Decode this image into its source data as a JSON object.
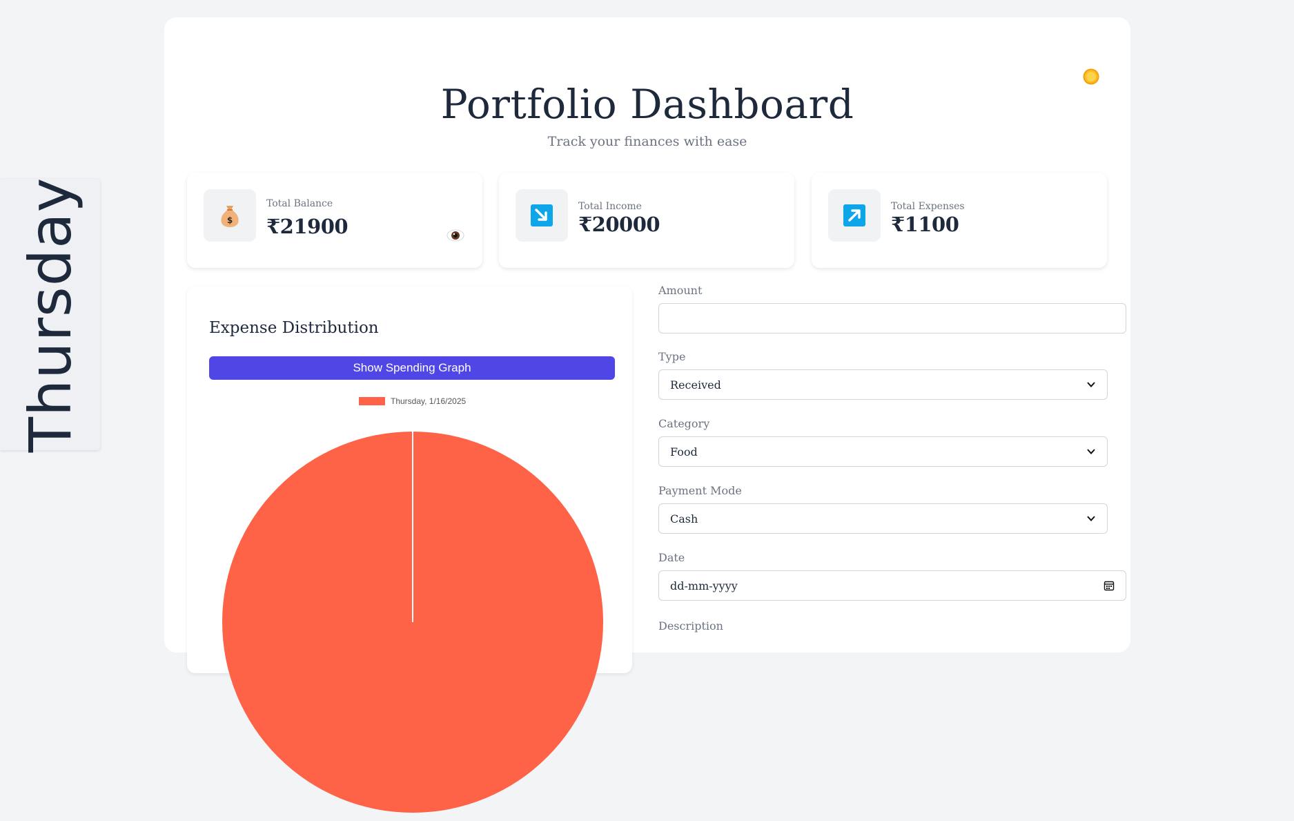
{
  "day_tab": {
    "label": "Thursday"
  },
  "header": {
    "title": "Portfolio Dashboard",
    "subtitle": "Track your finances with ease",
    "theme_icon": "sun-icon"
  },
  "stats": [
    {
      "label": "Total Balance",
      "value": "₹21900",
      "icon": "money-bag-icon"
    },
    {
      "label": "Total Income",
      "value": "₹20000",
      "icon": "arrow-down-right-icon",
      "accent": "#0ea5e9"
    },
    {
      "label": "Total Expenses",
      "value": "₹1100",
      "icon": "arrow-up-right-icon",
      "accent": "#0ea5e9"
    }
  ],
  "expense": {
    "title": "Expense Distribution",
    "graph_button": "Show Spending Graph",
    "chart_data": {
      "type": "pie",
      "categories": [
        "Thursday, 1/16/2025"
      ],
      "values": [
        100
      ],
      "colors": [
        "#ff6347"
      ],
      "legend_position": "top"
    }
  },
  "form": {
    "amount": {
      "label": "Amount",
      "value": "",
      "placeholder": ""
    },
    "type": {
      "label": "Type",
      "selected": "Received"
    },
    "category": {
      "label": "Category",
      "selected": "Food"
    },
    "payment_mode": {
      "label": "Payment Mode",
      "selected": "Cash"
    },
    "date": {
      "label": "Date",
      "placeholder": "dd-mm-yyyy"
    },
    "description": {
      "label": "Description"
    }
  },
  "colors": {
    "accent": "#4f46e5",
    "pie": "#ff6347",
    "icon_blue": "#0ea5e9"
  }
}
